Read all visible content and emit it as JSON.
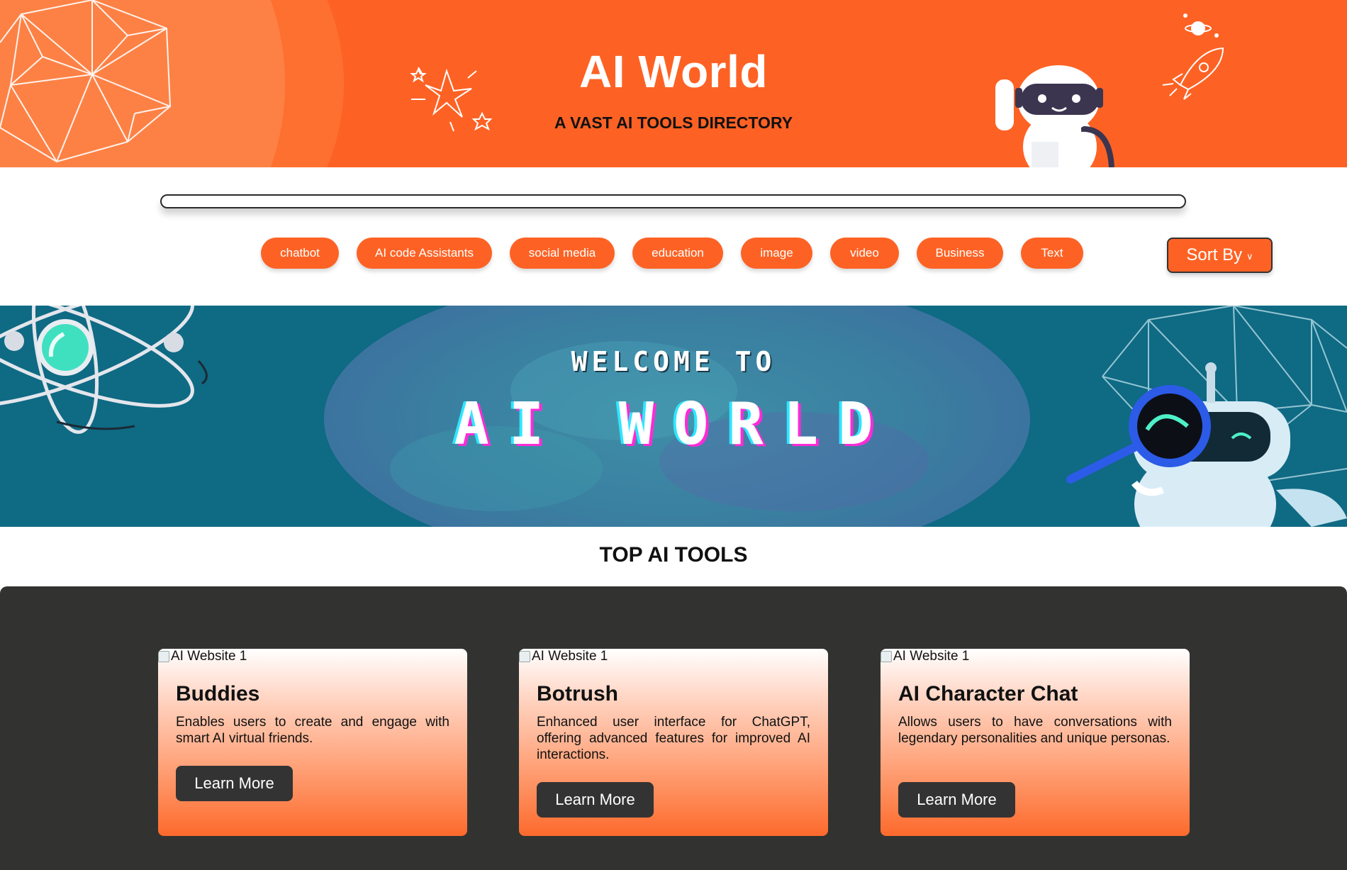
{
  "header": {
    "title": "AI World",
    "subtitle": "A VAST AI TOOLS DIRECTORY"
  },
  "search": {
    "placeholder": ""
  },
  "categories": [
    "chatbot",
    "AI code Assistants",
    "social media",
    "education",
    "image",
    "video",
    "Business",
    "Text"
  ],
  "sort": {
    "label": "Sort By",
    "icon": "chevron-down-icon"
  },
  "banner": {
    "welcome": "WELCOME TO",
    "headline": "AI WORLD"
  },
  "section": {
    "title": "TOP AI TOOLS"
  },
  "cards": [
    {
      "image_alt": "AI Website 1",
      "name": "Buddies",
      "description": "Enables users to create and engage with smart AI virtual friends.",
      "button": "Learn More"
    },
    {
      "image_alt": "AI Website 1",
      "name": "Botrush",
      "description": "Enhanced user interface for ChatGPT, offering advanced features for improved AI interactions.",
      "button": "Learn More"
    },
    {
      "image_alt": "AI Website 1",
      "name": "AI Character Chat",
      "description": "Allows users to have conversations with legendary personalities and unique personas.",
      "button": "Learn More"
    }
  ],
  "colors": {
    "brand_orange": "#fd6224",
    "banner_teal": "#0f6a84",
    "dark_panel": "#323331"
  }
}
